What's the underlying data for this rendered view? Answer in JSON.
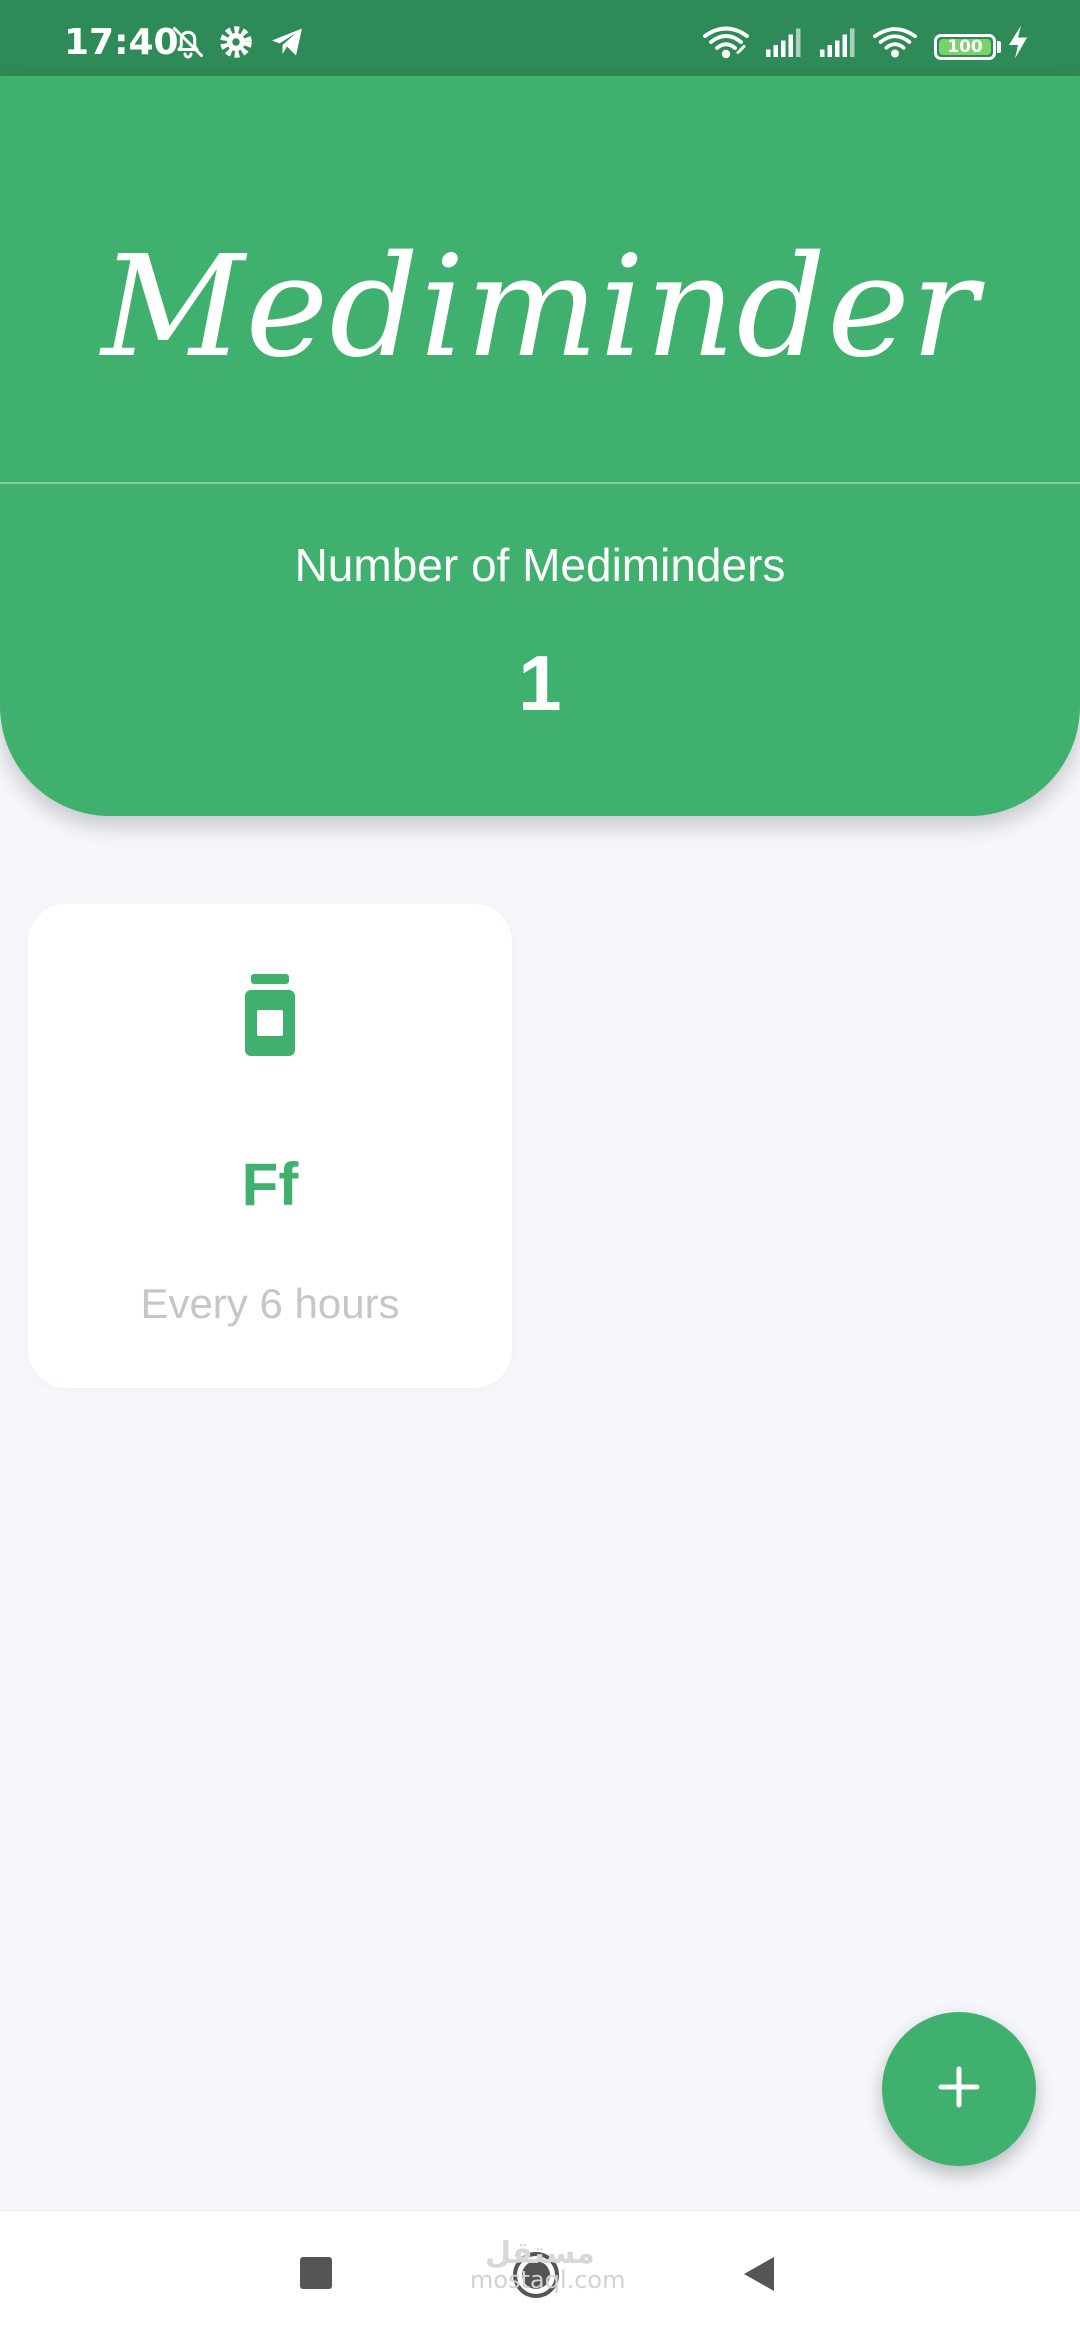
{
  "status_bar": {
    "time": "17:40",
    "battery_level": "100",
    "icons": [
      "bell-off-icon",
      "gear-icon",
      "telegram-icon",
      "wifi-link-icon",
      "signal-icon",
      "signal-icon",
      "wifi-icon",
      "battery-icon",
      "charging-icon"
    ]
  },
  "header": {
    "app_title": "Mediminder",
    "count_label": "Number of Mediminders",
    "count_value": "1"
  },
  "medicines": [
    {
      "icon": "pill-bottle-icon",
      "name": "Ff",
      "interval": "Every 6 hours"
    }
  ],
  "fab": {
    "icon": "plus-icon"
  },
  "nav_bar": {
    "buttons": [
      "recents-icon",
      "home-icon",
      "back-icon"
    ]
  },
  "watermark": {
    "arabic": "مستقل",
    "latin": "mostaql.com"
  },
  "colors": {
    "primary": "#3fb06d",
    "status_bar": "#2e8a57",
    "background": "#f5f7fb",
    "card": "#ffffff",
    "muted_text": "#c4c6ca"
  }
}
